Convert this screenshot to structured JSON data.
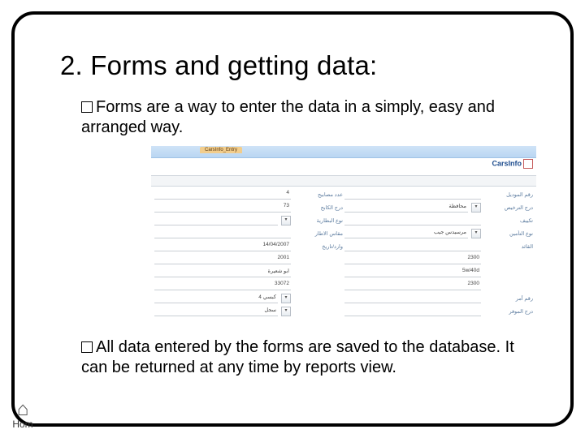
{
  "title": "2.  Forms and getting data:",
  "bullets": {
    "b1": "Forms are a way to enter the data in a simply, easy and arranged way.",
    "b2": "All data entered by the forms are saved to the database. It can be returned at any time by reports view."
  },
  "home": {
    "label": "Hom"
  },
  "form": {
    "tab": "CarsInfo_Entry",
    "logo": "CarsInfo",
    "left": {
      "r0": {
        "label": "عدد مصابيح",
        "value": "4"
      },
      "r1": {
        "label": "درج الكابح",
        "value": "73"
      },
      "r2": {
        "label": "نوع البطارية",
        "value": "",
        "dropdown": true
      },
      "r3": {
        "label": "مقاس الاطار",
        "value": ""
      },
      "r4": {
        "label": "وارد/تاريخ",
        "value": "14/04/2007"
      },
      "r5": {
        "label": "",
        "value": "2001"
      },
      "r6": {
        "label": "",
        "value": "ابو شعيرة"
      },
      "r7": {
        "label": "",
        "value": "33072"
      },
      "r8": {
        "label": "",
        "value": "4 كبسي",
        "dropdown": true
      },
      "r9": {
        "label": "",
        "value": "سجل",
        "dropdown": true
      }
    },
    "right": {
      "r0": {
        "label": "رقم الموديل",
        "value": ""
      },
      "r1": {
        "label": "درج الترخيص",
        "value": "محافظة",
        "dropdown": true
      },
      "r2": {
        "label": "تكييف",
        "value": ""
      },
      "r3": {
        "label": "نوع التأمين",
        "value": "مرسيدس جيب",
        "dropdown": true
      },
      "r4": {
        "label": "القائد",
        "value": ""
      },
      "r5": {
        "label": "",
        "value": "2300"
      },
      "r6": {
        "label": "",
        "value": "5w/40d"
      },
      "r7": {
        "label": "",
        "value": "2300"
      },
      "r8": {
        "label": "رقم أمر",
        "value": ""
      },
      "r9": {
        "label": "درج الموفر",
        "value": ""
      }
    }
  }
}
